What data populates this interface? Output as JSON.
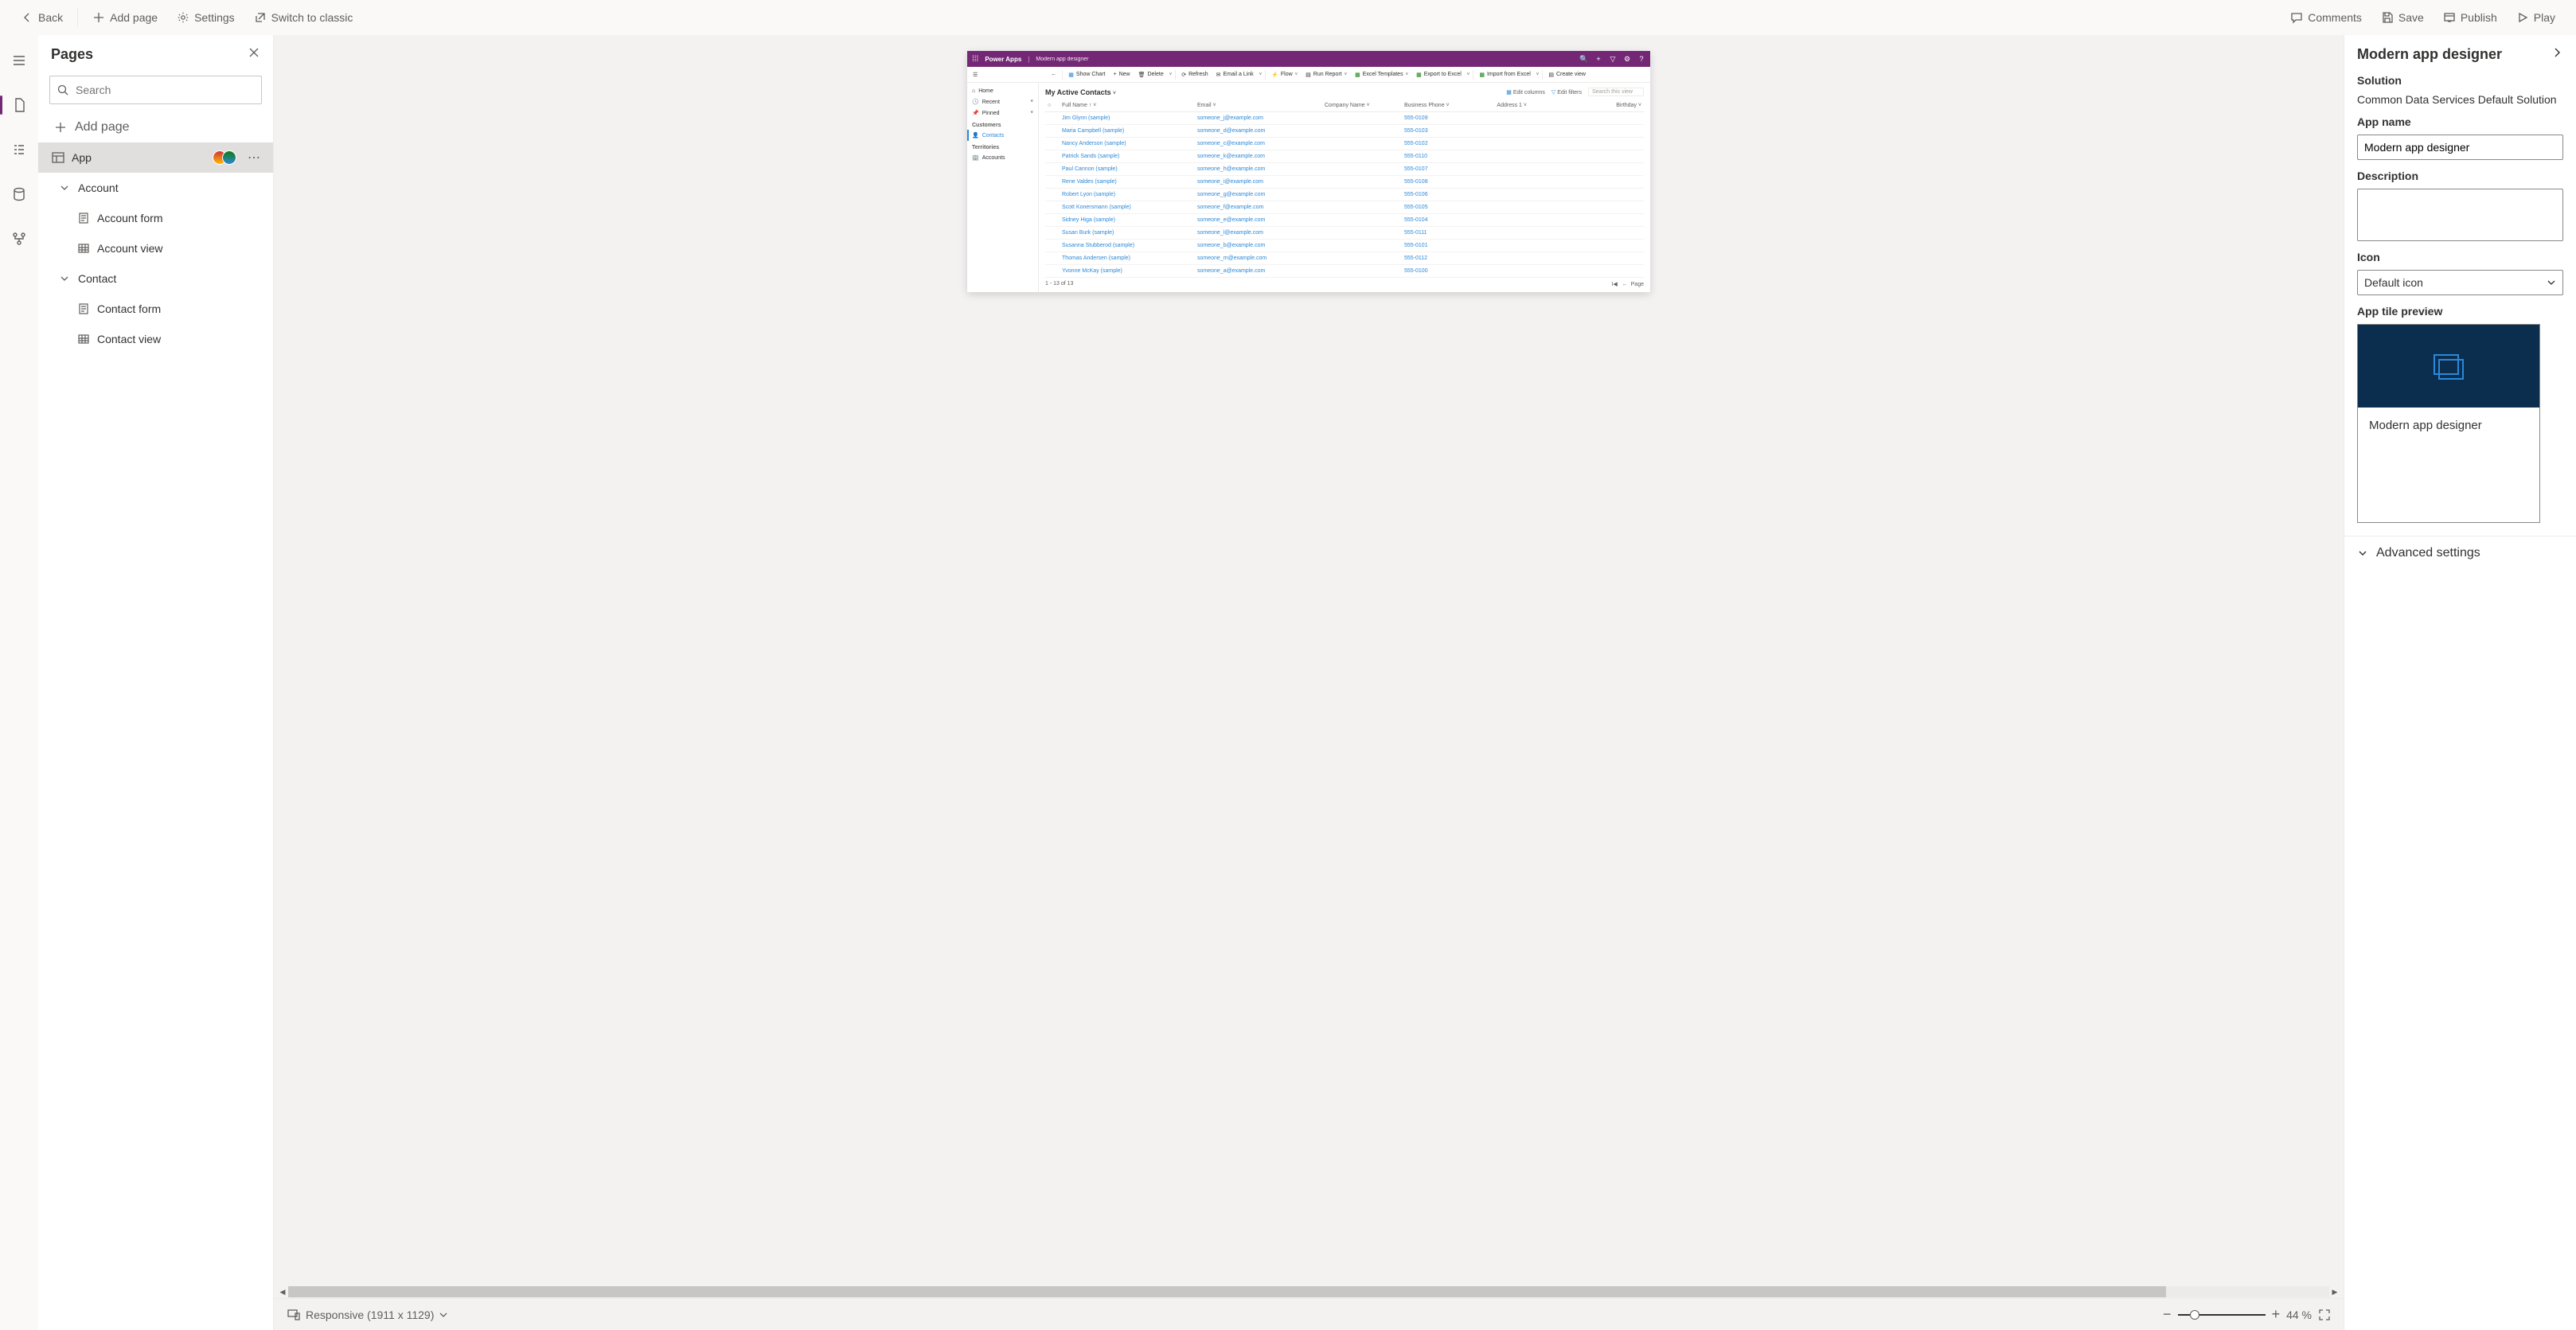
{
  "topbar": {
    "back": "Back",
    "add_page": "Add page",
    "settings": "Settings",
    "switch_classic": "Switch to classic",
    "comments": "Comments",
    "save": "Save",
    "publish": "Publish",
    "play": "Play"
  },
  "pages_panel": {
    "title": "Pages",
    "search_placeholder": "Search",
    "add_page": "Add page",
    "tree": {
      "app": "App",
      "account": "Account",
      "account_form": "Account form",
      "account_view": "Account view",
      "contact": "Contact",
      "contact_form": "Contact form",
      "contact_view": "Contact view"
    }
  },
  "canvas": {
    "brand": "Power Apps",
    "crumb": "Modern app designer",
    "cmd": {
      "show_chart": "Show Chart",
      "new": "New",
      "delete": "Delete",
      "refresh": "Refresh",
      "email_link": "Email a Link",
      "flow": "Flow",
      "run_report": "Run Report",
      "excel_templates": "Excel Templates",
      "export_excel": "Export to Excel",
      "import_excel": "Import from Excel",
      "create_view": "Create view"
    },
    "nav": {
      "home": "Home",
      "recent": "Recent",
      "pinned": "Pinned",
      "customers": "Customers",
      "contacts": "Contacts",
      "territories": "Territories",
      "accounts": "Accounts"
    },
    "view_name": "My Active Contacts",
    "view_tools": {
      "edit_columns": "Edit columns",
      "edit_filters": "Edit filters",
      "search_placeholder": "Search this view"
    },
    "columns": {
      "full_name": "Full Name",
      "email": "Email",
      "company": "Company Name",
      "phone": "Business Phone",
      "address": "Address 1",
      "birthday": "Birthday"
    },
    "rows": [
      {
        "name": "Jim Glynn (sample)",
        "email": "someone_j@example.com",
        "phone": "555-0109"
      },
      {
        "name": "Maria Campbell (sample)",
        "email": "someone_d@example.com",
        "phone": "555-0103"
      },
      {
        "name": "Nancy Anderson (sample)",
        "email": "someone_c@example.com",
        "phone": "555-0102"
      },
      {
        "name": "Patrick Sands (sample)",
        "email": "someone_k@example.com",
        "phone": "555-0110"
      },
      {
        "name": "Paul Cannon (sample)",
        "email": "someone_h@example.com",
        "phone": "555-0107"
      },
      {
        "name": "Rene Valdes (sample)",
        "email": "someone_i@example.com",
        "phone": "555-0108"
      },
      {
        "name": "Robert Lyon (sample)",
        "email": "someone_g@example.com",
        "phone": "555-0106"
      },
      {
        "name": "Scott Konersmann (sample)",
        "email": "someone_f@example.com",
        "phone": "555-0105"
      },
      {
        "name": "Sidney Higa (sample)",
        "email": "someone_e@example.com",
        "phone": "555-0104"
      },
      {
        "name": "Susan Burk (sample)",
        "email": "someone_l@example.com",
        "phone": "555-0111"
      },
      {
        "name": "Susanna Stubberod (sample)",
        "email": "someone_b@example.com",
        "phone": "555-0101"
      },
      {
        "name": "Thomas Andersen (sample)",
        "email": "someone_m@example.com",
        "phone": "555-0112"
      },
      {
        "name": "Yvonne McKay (sample)",
        "email": "someone_a@example.com",
        "phone": "555-0100"
      }
    ],
    "footer_range": "1 - 13 of 13",
    "footer_page": "Page"
  },
  "canvas_footer": {
    "responsive_label": "Responsive (1911 x 1129)",
    "zoom_pct": "44 %"
  },
  "props": {
    "title": "Modern app designer",
    "solution_label": "Solution",
    "solution_value": "Common Data Services Default Solution",
    "appname_label": "App name",
    "appname_value": "Modern app designer",
    "description_label": "Description",
    "description_value": "",
    "icon_label": "Icon",
    "icon_value": "Default icon",
    "tile_label": "App tile preview",
    "tile_name": "Modern app designer",
    "advanced": "Advanced settings"
  }
}
